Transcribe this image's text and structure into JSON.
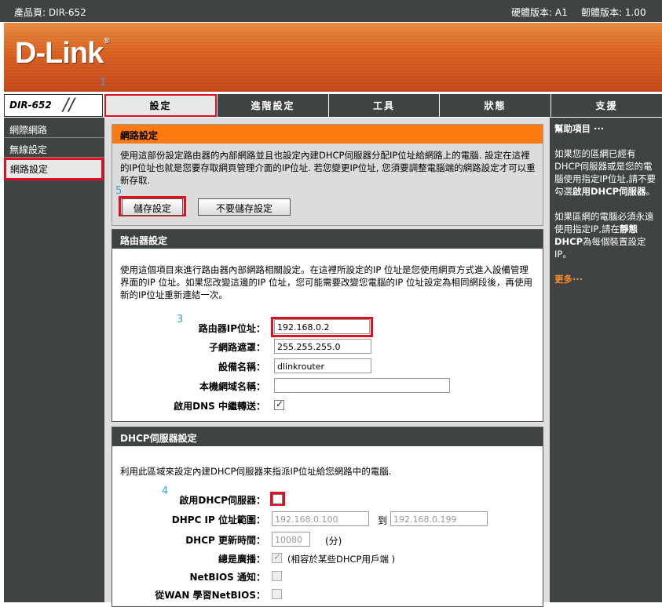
{
  "topbar": {
    "product": "產品頁: DIR-652",
    "hw": "硬體版本: A1",
    "fw": "韌體版本: 1.00"
  },
  "logo": {
    "text": "D-Link",
    "reg": "®"
  },
  "model": "DIR-652",
  "tabs": [
    "設定",
    "進階設定",
    "工具",
    "狀態",
    "支援"
  ],
  "sidebar": {
    "items": [
      "網際網路",
      "無線設定",
      "網路設定"
    ]
  },
  "annotations": {
    "n1": "1",
    "n3": "3",
    "n4": "4",
    "n5": "5"
  },
  "network": {
    "title": "網路設定",
    "desc": "使用這部份設定路由器的內部網路並且也設定內建DHCP伺服器分配IP位址給網路上的電腦. 設定在這裡的IP位址也就是您要存取網頁管理介面的IP位址. 若您變更IP位址, 您須要調整電腦端的網路設定才可以重新存取.",
    "save": "儲存設定",
    "nosave": "不要儲存設定"
  },
  "router": {
    "title": "路由器設定",
    "desc": "使用這個項目來進行路由器內部網路相關設定。在這裡所設定的IP 位址是您使用網頁方式進入設備管理界面的IP 位址。如果您改變這邊的IP 位址，您可能需要改變您電腦的IP 位址設定為相同網段後，再使用新的IP位址重新連結一次。",
    "ip_label": "路由器IP位址：",
    "ip_value": "192.168.0.2",
    "mask_label": "子網路遮罩：",
    "mask_value": "255.255.255.0",
    "name_label": "設備名稱：",
    "name_value": "dlinkrouter",
    "domain_label": "本機網域名稱：",
    "domain_value": "",
    "dns_label": "啟用DNS 中繼轉送：",
    "dns_checked": true
  },
  "dhcp": {
    "title": "DHCP伺服器設定",
    "desc": "利用此區域來設定內建DHCP伺服器來指派IP位址給您網路中的電腦.",
    "enable_label": "啟用DHCP伺服器：",
    "enable_checked": false,
    "range_label": "DHPC IP 位址範圍：",
    "range_start": "192.168.0.100",
    "range_to": "到",
    "range_end": "192.168.0.199",
    "lease_label": "DHCP 更新時間：",
    "lease_value": "10080",
    "lease_unit": "(分)",
    "broadcast_label": "總是廣播：",
    "broadcast_note": "(相容於某些DHCP用戶端 )",
    "netbios_label": "NetBIOS 通知：",
    "wan_netbios_label": "從WAN 學習NetBIOS："
  },
  "help": {
    "title": "幫助項目 ···",
    "p1_a": "如果您的區網已經有DHCP伺服器或是您的電腦使用指定IP位址,請不要勾選",
    "p1_b": "啟用DHCP伺服器",
    "p1_c": "。",
    "p2_a": "如果區網的電腦必須永遠使用指定IP,請在",
    "p2_b": "靜態DHCP",
    "p2_c": "為每個裝置設定IP。",
    "more": "更多···"
  }
}
